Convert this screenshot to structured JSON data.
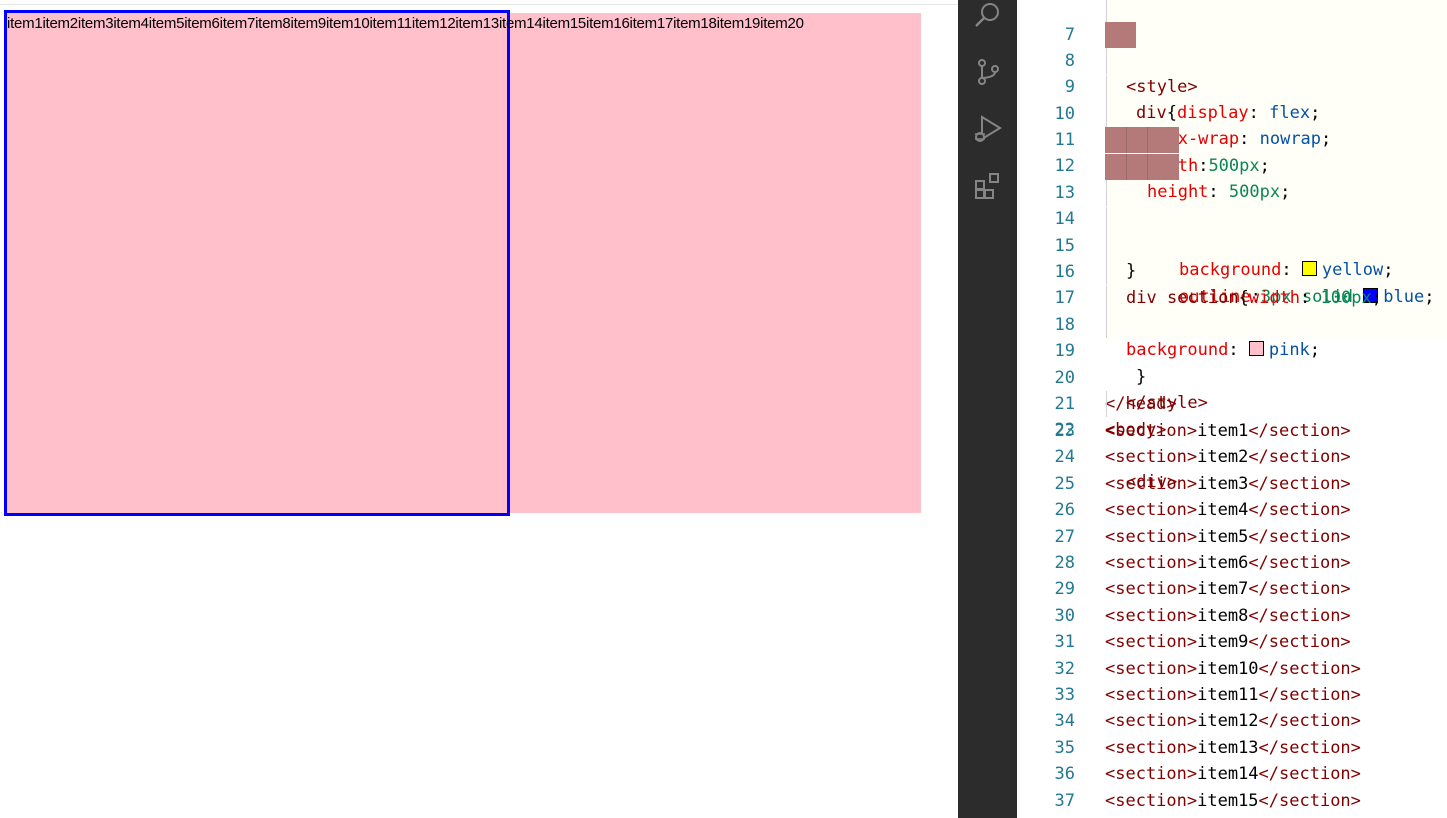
{
  "preview": {
    "items": [
      "item1",
      "item2",
      "item3",
      "item4",
      "item5",
      "item6",
      "item7",
      "item8",
      "item9",
      "item10",
      "item11",
      "item12",
      "item13",
      "item14",
      "item15",
      "item16",
      "item17",
      "item18",
      "item19",
      "item20"
    ]
  },
  "activity_bar": {
    "icons": [
      "search-icon",
      "source-control-icon",
      "run-debug-icon",
      "extensions-icon"
    ]
  },
  "editor": {
    "line_numbers": [
      "7",
      "8",
      "9",
      "10",
      "11",
      "12",
      "13",
      "14",
      "15",
      "16",
      "17",
      "18",
      "19",
      "20",
      "21",
      "22",
      "23",
      "24",
      "25",
      "26",
      "27",
      "28",
      "29",
      "30",
      "31",
      "32",
      "33",
      "34",
      "35",
      "36",
      "37"
    ],
    "tokens": {
      "l7": [
        "<style>"
      ],
      "l8": [
        "div",
        "{",
        "display",
        ": ",
        "flex",
        ";"
      ],
      "l9": [
        "flex-wrap",
        ": ",
        "nowrap",
        ";"
      ],
      "l10": [
        "width",
        ":",
        "500px",
        ";"
      ],
      "l11": [
        "height",
        ": ",
        "500px",
        ";"
      ],
      "l12": [
        "background",
        ": ",
        "yellow",
        ";"
      ],
      "l13": [
        "outline",
        ":",
        "3px solid ",
        "blue",
        ";"
      ],
      "l14": [
        "}"
      ],
      "l15": [
        "div section",
        "{",
        "width",
        ": ",
        "100px",
        ";"
      ],
      "l17": [
        "background",
        ": ",
        "pink",
        ";"
      ],
      "l18": [
        "}"
      ],
      "l19": [
        "</style>"
      ],
      "l20": [
        "</head>"
      ],
      "l21": [
        "<body>"
      ],
      "l22": [
        "<div>"
      ],
      "sections": [
        "item1",
        "item2",
        "item3",
        "item4",
        "item5",
        "item6",
        "item7",
        "item8",
        "item9",
        "item10",
        "item11",
        "item12",
        "item13",
        "item14",
        "item15"
      ],
      "open_tag": "<section>",
      "close_tag": "</section>"
    },
    "colors": {
      "swatch_yellow": "#ffff00",
      "swatch_blue": "#0000ff",
      "swatch_pink": "#ffc0cb"
    }
  }
}
